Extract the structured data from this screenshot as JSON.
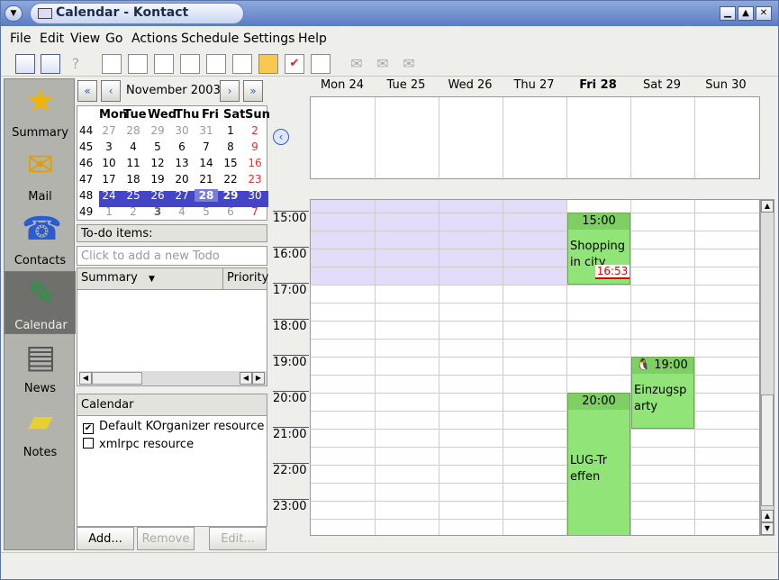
{
  "window": {
    "title": "Calendar - Kontact"
  },
  "menu": [
    "File",
    "Edit",
    "View",
    "Go",
    "Actions",
    "Schedule",
    "Settings",
    "Help"
  ],
  "sidebar": [
    {
      "label": "Summary",
      "icon": "star-icon"
    },
    {
      "label": "Mail",
      "icon": "mail-icon"
    },
    {
      "label": "Contacts",
      "icon": "phone-icon"
    },
    {
      "label": "Calendar",
      "icon": "calendar-icon"
    },
    {
      "label": "News",
      "icon": "newspaper-icon"
    },
    {
      "label": "Notes",
      "icon": "note-icon"
    }
  ],
  "navigator": {
    "month": "November 2003",
    "headers": [
      "Mon",
      "Tue",
      "Wed",
      "Thu",
      "Fri",
      "Sat",
      "Sun"
    ],
    "weeks": [
      {
        "wk": "44",
        "days": [
          "27",
          "28",
          "29",
          "30",
          "31",
          "1",
          "2"
        ]
      },
      {
        "wk": "45",
        "days": [
          "3",
          "4",
          "5",
          "6",
          "7",
          "8",
          "9"
        ]
      },
      {
        "wk": "46",
        "days": [
          "10",
          "11",
          "12",
          "13",
          "14",
          "15",
          "16"
        ]
      },
      {
        "wk": "47",
        "days": [
          "17",
          "18",
          "19",
          "20",
          "21",
          "22",
          "23"
        ]
      },
      {
        "wk": "48",
        "days": [
          "24",
          "25",
          "26",
          "27",
          "28",
          "29",
          "30"
        ]
      },
      {
        "wk": "49",
        "days": [
          "1",
          "2",
          "3",
          "4",
          "5",
          "6",
          "7"
        ]
      }
    ]
  },
  "todo": {
    "label": "To-do items:",
    "placeholder": "Click to add a new Todo",
    "col_summary": "Summary",
    "col_priority": "Priority"
  },
  "calendars": {
    "header": "Calendar",
    "items": [
      {
        "name": "Default KOrganizer resource",
        "checked": true
      },
      {
        "name": "xmlrpc resource",
        "checked": false
      }
    ]
  },
  "buttons": {
    "add": "Add...",
    "remove": "Remove",
    "edit": "Edit..."
  },
  "days": [
    "Mon 24",
    "Tue 25",
    "Wed 26",
    "Thu 27",
    "Fri 28",
    "Sat 29",
    "Sun 30"
  ],
  "times": [
    "15:00",
    "16:00",
    "17:00",
    "18:00",
    "19:00",
    "20:00",
    "21:00",
    "22:00",
    "23:00"
  ],
  "events": [
    {
      "time": "15:00",
      "title": "Shopping in city",
      "now": "16:53"
    },
    {
      "time": "19:00",
      "title": "Einzugsparty"
    },
    {
      "time": "20:00",
      "title": "LUG-Treffen"
    }
  ]
}
